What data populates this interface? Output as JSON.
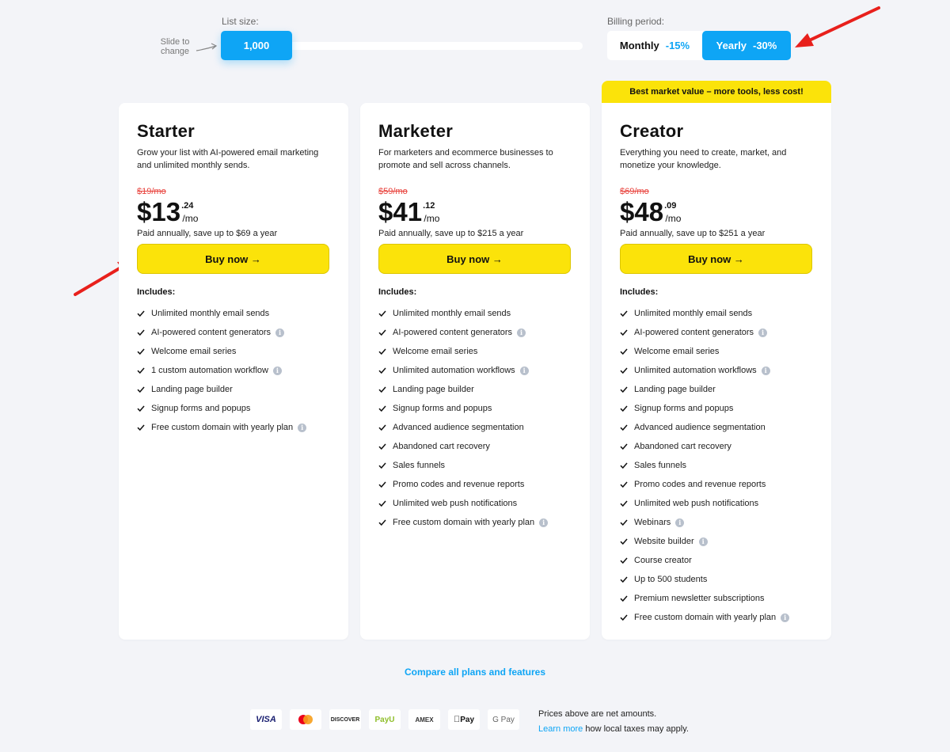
{
  "controls": {
    "list_size_label": "List size:",
    "slide_hint": "Slide to change",
    "list_size_value": "1,000",
    "billing_label": "Billing period:",
    "monthly_label": "Monthly",
    "monthly_discount": "-15%",
    "yearly_label": "Yearly",
    "yearly_discount": "-30%",
    "selected_billing": "Yearly"
  },
  "ribbon": "Best market value – more tools, less cost!",
  "plans": [
    {
      "name": "Starter",
      "description": "Grow your list with AI-powered email marketing and unlimited monthly sends.",
      "old_price": "$19/mo",
      "price_main": "$13",
      "price_cents": ".24",
      "price_unit": "/mo",
      "save_text": "Paid annually, save up to $69 a year",
      "buy_label": "Buy now →",
      "includes_label": "Includes:",
      "features": [
        {
          "text": "Unlimited monthly email sends",
          "info": false
        },
        {
          "text": "AI-powered content generators",
          "info": true
        },
        {
          "text": "Welcome email series",
          "info": false
        },
        {
          "text": "1 custom automation workflow",
          "info": true
        },
        {
          "text": "Landing page builder",
          "info": false
        },
        {
          "text": "Signup forms and popups",
          "info": false
        },
        {
          "text": "Free custom domain with yearly plan",
          "info": true
        }
      ]
    },
    {
      "name": "Marketer",
      "description": "For marketers and ecommerce businesses to promote and sell across channels.",
      "old_price": "$59/mo",
      "price_main": "$41",
      "price_cents": ".12",
      "price_unit": "/mo",
      "save_text": "Paid annually, save up to $215 a year",
      "buy_label": "Buy now →",
      "includes_label": "Includes:",
      "features": [
        {
          "text": "Unlimited monthly email sends",
          "info": false
        },
        {
          "text": "AI-powered content generators",
          "info": true
        },
        {
          "text": "Welcome email series",
          "info": false
        },
        {
          "text": "Unlimited automation workflows",
          "info": true
        },
        {
          "text": "Landing page builder",
          "info": false
        },
        {
          "text": "Signup forms and popups",
          "info": false
        },
        {
          "text": "Advanced audience segmentation",
          "info": false
        },
        {
          "text": "Abandoned cart recovery",
          "info": false
        },
        {
          "text": "Sales funnels",
          "info": false
        },
        {
          "text": "Promo codes and revenue reports",
          "info": false
        },
        {
          "text": "Unlimited web push notifications",
          "info": false
        },
        {
          "text": "Free custom domain with yearly plan",
          "info": true
        }
      ]
    },
    {
      "name": "Creator",
      "description": "Everything you need to create, market, and monetize your knowledge.",
      "old_price": "$69/mo",
      "price_main": "$48",
      "price_cents": ".09",
      "price_unit": "/mo",
      "save_text": "Paid annually, save up to $251 a year",
      "buy_label": "Buy now →",
      "includes_label": "Includes:",
      "features": [
        {
          "text": "Unlimited monthly email sends",
          "info": false
        },
        {
          "text": "AI-powered content generators",
          "info": true
        },
        {
          "text": "Welcome email series",
          "info": false
        },
        {
          "text": "Unlimited automation workflows",
          "info": true
        },
        {
          "text": "Landing page builder",
          "info": false
        },
        {
          "text": "Signup forms and popups",
          "info": false
        },
        {
          "text": "Advanced audience segmentation",
          "info": false
        },
        {
          "text": "Abandoned cart recovery",
          "info": false
        },
        {
          "text": "Sales funnels",
          "info": false
        },
        {
          "text": "Promo codes and revenue reports",
          "info": false
        },
        {
          "text": "Unlimited web push notifications",
          "info": false
        },
        {
          "text": "Webinars",
          "info": true
        },
        {
          "text": "Website builder",
          "info": true
        },
        {
          "text": "Course creator",
          "info": false
        },
        {
          "text": "Up to 500 students",
          "info": false
        },
        {
          "text": "Premium newsletter subscriptions",
          "info": false
        },
        {
          "text": "Free custom domain with yearly plan",
          "info": true
        }
      ]
    }
  ],
  "footer": {
    "compare_link": "Compare all plans and features",
    "payment_methods": [
      "VISA",
      "Mastercard",
      "DISCOVER",
      "PayU",
      "AMEX",
      "Pay",
      "G Pay"
    ],
    "tax_line1": "Prices above are net amounts.",
    "tax_link": "Learn more",
    "tax_line2": "how local taxes may apply."
  },
  "colors": {
    "accent_blue": "#0ea5f5",
    "cta_yellow": "#fbe30a",
    "strike_red": "#e8413b",
    "annotation_red": "#e8201c",
    "background": "#f3f4f8"
  }
}
